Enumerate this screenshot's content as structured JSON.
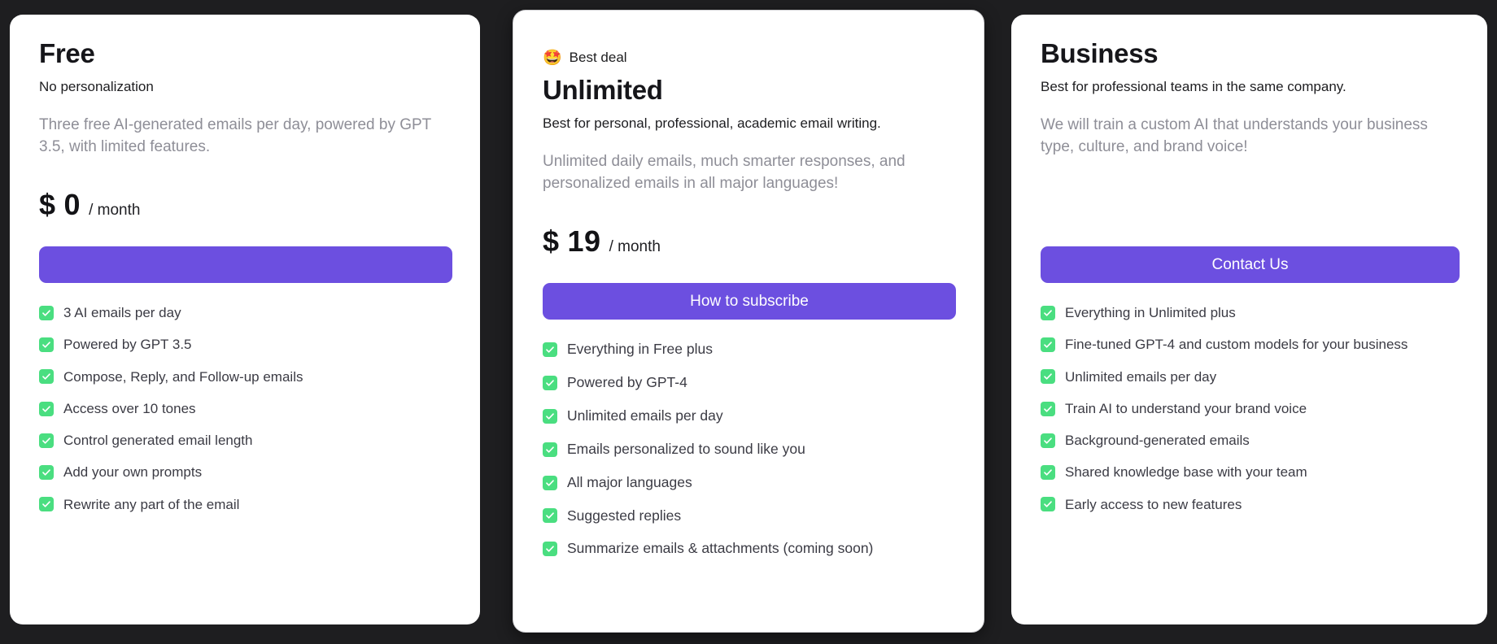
{
  "theme": {
    "background": "#1e1e20",
    "card_background": "#ffffff",
    "accent_purple": "#6c4fe0",
    "check_green": "#4ade80",
    "muted_text": "#8e8e97"
  },
  "plans": [
    {
      "id": "free",
      "name": "Free",
      "tagline": "No personalization",
      "description": "Three free AI-generated emails per day, powered by GPT 3.5, with limited features.",
      "currency": "$",
      "price": "0",
      "period": "/ month",
      "cta_label": "",
      "features": [
        "3 AI emails per day",
        "Powered by GPT 3.5",
        "Compose, Reply, and Follow-up emails",
        "Access over 10 tones",
        "Control generated email length",
        "Add your own prompts",
        "Rewrite any part of the email"
      ]
    },
    {
      "id": "unlimited",
      "badge_emoji": "🤩",
      "badge_label": "Best deal",
      "name": "Unlimited",
      "tagline": "Best for personal, professional, academic email writing.",
      "description": "Unlimited daily emails, much smarter responses, and personalized emails in all major languages!",
      "currency": "$",
      "price": "19",
      "period": "/ month",
      "cta_label": "How to subscribe",
      "features": [
        "Everything in Free plus",
        "Powered by GPT-4",
        "Unlimited emails per day",
        "Emails personalized to sound like you",
        "All major languages",
        "Suggested replies",
        "Summarize emails & attachments (coming soon)"
      ]
    },
    {
      "id": "business",
      "name": "Business",
      "tagline": "Best for professional teams in the same company.",
      "description": "We will train a custom AI that understands your business type, culture, and brand voice!",
      "currency": "",
      "price": "",
      "period": "",
      "cta_label": "Contact Us",
      "features": [
        "Everything in Unlimited plus",
        "Fine-tuned GPT-4 and custom models for your business",
        "Unlimited emails per day",
        "Train AI to understand your brand voice",
        "Background-generated emails",
        "Shared knowledge base with your team",
        "Early access to new features"
      ]
    }
  ]
}
